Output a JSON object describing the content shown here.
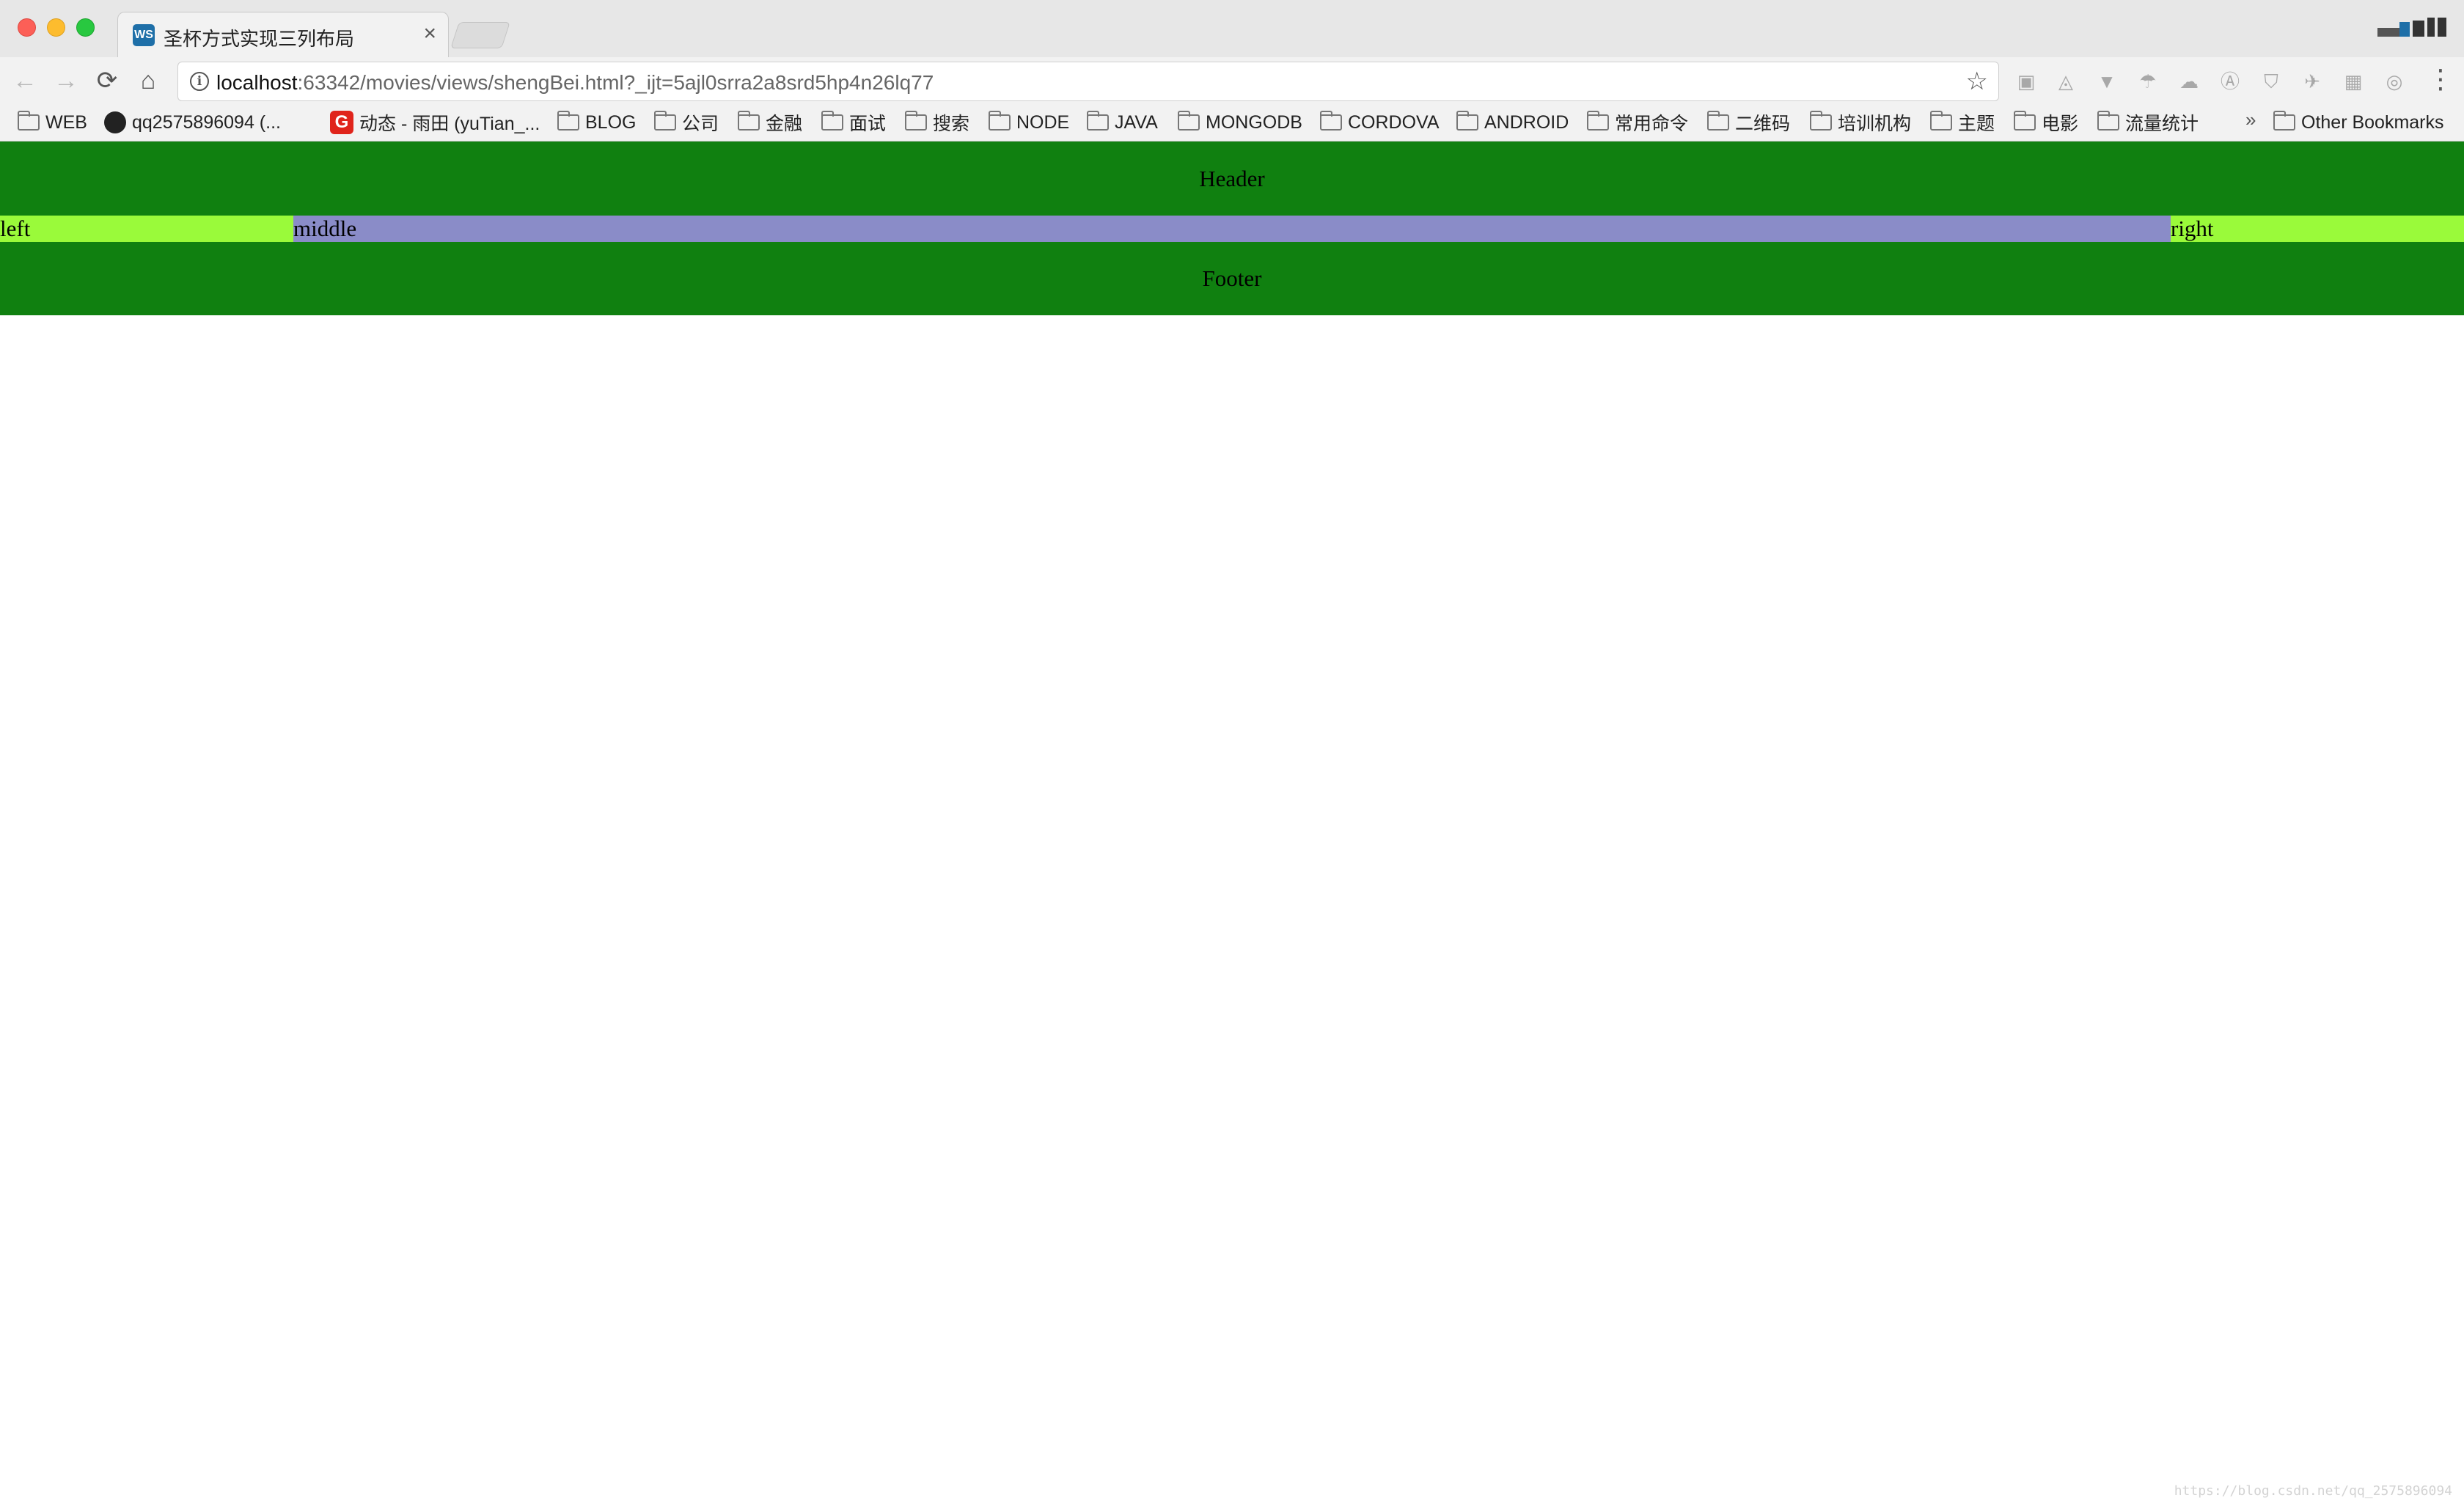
{
  "browser": {
    "tab": {
      "title": "圣杯方式实现三列布局",
      "close": "×",
      "favicon": "webstorm-icon"
    },
    "nav": {
      "back": "←",
      "forward": "→",
      "reload": "⟳",
      "home": "⌂"
    },
    "address": {
      "host": "localhost",
      "rest": ":63342/movies/views/shengBei.html?_ijt=5ajl0srra2a8srd5hp4n26lq77",
      "star": "☆"
    },
    "menu": "⋮",
    "bookmarks": [
      {
        "label": "WEB",
        "icon": "folder-icon"
      },
      {
        "label": "qq2575896094 (...",
        "icon": "github-icon"
      },
      {
        "label": "动态 - 雨田 (yuTian_...",
        "icon": "gitee-icon"
      },
      {
        "label": "BLOG",
        "icon": "folder-icon"
      },
      {
        "label": "公司",
        "icon": "folder-icon"
      },
      {
        "label": "金融",
        "icon": "folder-icon"
      },
      {
        "label": "面试",
        "icon": "folder-icon"
      },
      {
        "label": "搜索",
        "icon": "folder-icon"
      },
      {
        "label": "NODE",
        "icon": "folder-icon"
      },
      {
        "label": "JAVA",
        "icon": "folder-icon"
      },
      {
        "label": "MONGODB",
        "icon": "folder-icon"
      },
      {
        "label": "CORDOVA",
        "icon": "folder-icon"
      },
      {
        "label": "ANDROID",
        "icon": "folder-icon"
      },
      {
        "label": "常用命令",
        "icon": "folder-icon"
      },
      {
        "label": "二维码",
        "icon": "folder-icon"
      },
      {
        "label": "培训机构",
        "icon": "folder-icon"
      },
      {
        "label": "主题",
        "icon": "folder-icon"
      },
      {
        "label": "电影",
        "icon": "folder-icon"
      },
      {
        "label": "流量统计",
        "icon": "folder-icon"
      }
    ],
    "overflow": "»",
    "other_bookmarks": "Other Bookmarks"
  },
  "page": {
    "header": "Header",
    "left": "left",
    "middle": "middle",
    "right": "right",
    "footer": "Footer",
    "watermark": "https://blog.csdn.net/qq_2575896094"
  },
  "colors": {
    "header_footer": "#108010",
    "side_columns": "#9afa3a",
    "middle_column": "#8a8cc8"
  }
}
